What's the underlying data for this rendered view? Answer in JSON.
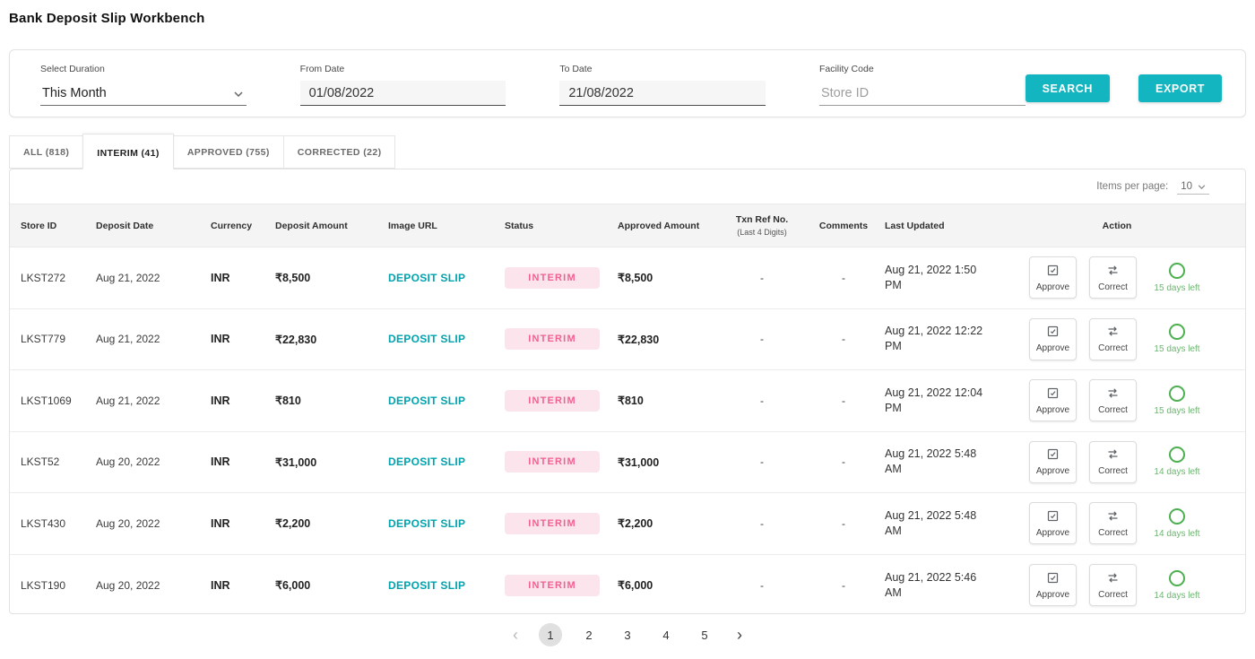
{
  "page": {
    "title": "Bank Deposit Slip Workbench"
  },
  "filters": {
    "duration": {
      "label": "Select Duration",
      "value": "This Month"
    },
    "from_date": {
      "label": "From Date",
      "value": "01/08/2022"
    },
    "to_date": {
      "label": "To Date",
      "value": "21/08/2022"
    },
    "facility_code": {
      "label": "Facility Code",
      "placeholder": "Store ID"
    },
    "search_label": "SEARCH",
    "export_label": "EXPORT"
  },
  "tabs": [
    {
      "label": "ALL (818)",
      "active": false
    },
    {
      "label": "INTERIM (41)",
      "active": true
    },
    {
      "label": "APPROVED (755)",
      "active": false
    },
    {
      "label": "CORRECTED (22)",
      "active": false
    }
  ],
  "table": {
    "items_per_page_label": "Items per page:",
    "items_per_page_value": "10",
    "headers": [
      "Store ID",
      "Deposit Date",
      "Currency",
      "Deposit Amount",
      "Image URL",
      "Status",
      "Approved Amount",
      "Txn Ref No.",
      "Comments",
      "Last Updated",
      "Action"
    ],
    "txn_ref_subtext": "(Last 4 Digits)",
    "image_link_label": "DEPOSIT SLIP",
    "approve_label": "Approve",
    "correct_label": "Correct",
    "rows": [
      {
        "store_id": "LKST272",
        "deposit_date": "Aug 21, 2022",
        "currency": "INR",
        "deposit_amount": "₹8,500",
        "status": "INTERIM",
        "approved_amount": "₹8,500",
        "txn_ref": "-",
        "comments": "-",
        "last_updated": "Aug 21, 2022 1:50 PM",
        "days_left": "15 days left"
      },
      {
        "store_id": "LKST779",
        "deposit_date": "Aug 21, 2022",
        "currency": "INR",
        "deposit_amount": "₹22,830",
        "status": "INTERIM",
        "approved_amount": "₹22,830",
        "txn_ref": "-",
        "comments": "-",
        "last_updated": "Aug 21, 2022 12:22 PM",
        "days_left": "15 days left"
      },
      {
        "store_id": "LKST1069",
        "deposit_date": "Aug 21, 2022",
        "currency": "INR",
        "deposit_amount": "₹810",
        "status": "INTERIM",
        "approved_amount": "₹810",
        "txn_ref": "-",
        "comments": "-",
        "last_updated": "Aug 21, 2022 12:04 PM",
        "days_left": "15 days left"
      },
      {
        "store_id": "LKST52",
        "deposit_date": "Aug 20, 2022",
        "currency": "INR",
        "deposit_amount": "₹31,000",
        "status": "INTERIM",
        "approved_amount": "₹31,000",
        "txn_ref": "-",
        "comments": "-",
        "last_updated": "Aug 21, 2022 5:48 AM",
        "days_left": "14 days left"
      },
      {
        "store_id": "LKST430",
        "deposit_date": "Aug 20, 2022",
        "currency": "INR",
        "deposit_amount": "₹2,200",
        "status": "INTERIM",
        "approved_amount": "₹2,200",
        "txn_ref": "-",
        "comments": "-",
        "last_updated": "Aug 21, 2022 5:48 AM",
        "days_left": "14 days left"
      },
      {
        "store_id": "LKST190",
        "deposit_date": "Aug 20, 2022",
        "currency": "INR",
        "deposit_amount": "₹6,000",
        "status": "INTERIM",
        "approved_amount": "₹6,000",
        "txn_ref": "-",
        "comments": "-",
        "last_updated": "Aug 21, 2022 5:46 AM",
        "days_left": "14 days left"
      }
    ]
  },
  "pagination": {
    "prev_icon": "‹",
    "next_icon": "›",
    "pages": [
      "1",
      "2",
      "3",
      "4",
      "5"
    ],
    "current": "1"
  },
  "colors": {
    "accent_teal": "#13B5C0",
    "link_teal": "#00A3AE",
    "badge_bg": "#FCE4EC",
    "badge_text": "#F06292",
    "success_green": "#4CAF50"
  }
}
